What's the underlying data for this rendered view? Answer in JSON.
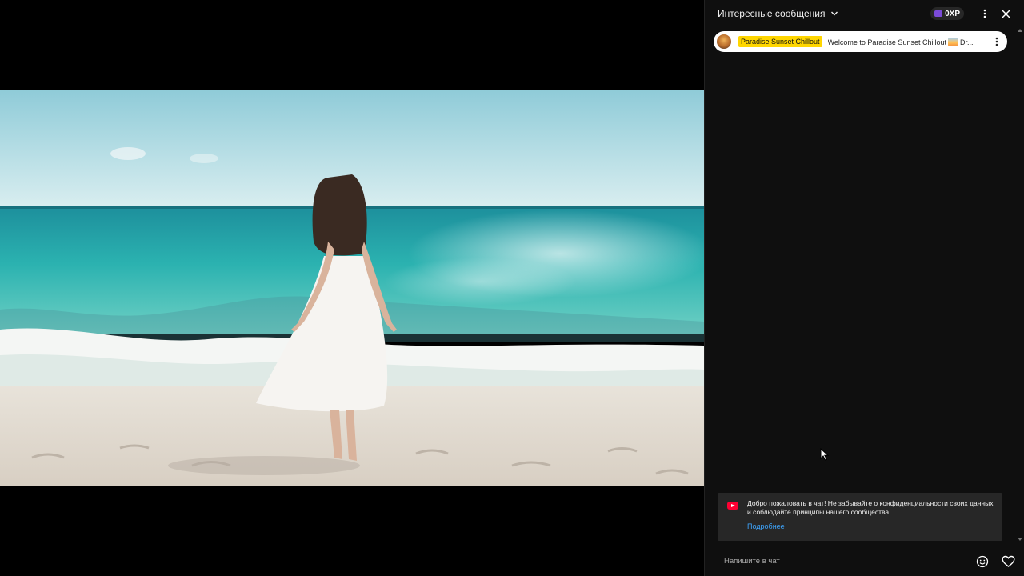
{
  "chat": {
    "title": "Интересные сообщения",
    "xp_label": "0XP",
    "pinned": {
      "author": "Paradise Sunset Chillout",
      "message_prefix": "Welcome to Paradise Sunset Chillout",
      "message_suffix": "Dr..."
    },
    "welcome": {
      "text": "Добро пожаловать в чат! Не забывайте о конфиденциальности своих данных и соблюдайте принципы нашего сообщества.",
      "link": "Подробнее"
    },
    "input": {
      "placeholder": "Напишите в чат"
    }
  },
  "icons": {
    "title_chevron": "chevron-down-icon",
    "xp": "xp-icon",
    "header_more": "more-vert-icon",
    "close": "close-icon",
    "pinned_more": "more-vert-icon",
    "emoji": "emoji-icon",
    "heart": "heart-icon",
    "youtube": "youtube-icon"
  },
  "colors": {
    "chat_bg": "#0f0f0f",
    "badge_yellow": "#ffd600",
    "link_blue": "#3ea6ff",
    "youtube_red": "#ff0033"
  }
}
